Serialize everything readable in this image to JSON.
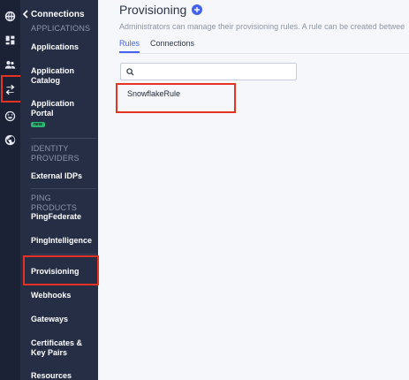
{
  "nav": {
    "back_label": "Connections",
    "sections": {
      "applications": "APPLICATIONS",
      "identity_providers": "IDENTITY PROVIDERS",
      "ping_products": "PING PRODUCTS"
    },
    "items": {
      "applications": "Applications",
      "application_catalog": "Application Catalog",
      "application_portal": "Application Portal",
      "application_portal_badge": "new",
      "external_idps": "External IDPs",
      "pingfederate": "PingFederate",
      "pingintelligence": "PingIntelligence",
      "provisioning": "Provisioning",
      "webhooks": "Webhooks",
      "gateways": "Gateways",
      "certificates": "Certificates & Key Pairs",
      "resources": "Resources"
    }
  },
  "rail": {
    "icons": [
      "globe-icon",
      "dashboard-icon",
      "users-icon",
      "connections-icon",
      "smiley-icon",
      "globe-alt-icon"
    ]
  },
  "main": {
    "title": "Provisioning",
    "description": "Administrators can manage their provisioning rules. A rule can be created betwee",
    "tabs": [
      "Rules",
      "Connections"
    ],
    "search_placeholder": "",
    "rules": [
      "SnowflakeRule"
    ]
  },
  "colors": {
    "accent": "#4462ed",
    "highlight": "#e53223",
    "rail_bg": "#1b2236",
    "nav_bg": "#252e45"
  }
}
